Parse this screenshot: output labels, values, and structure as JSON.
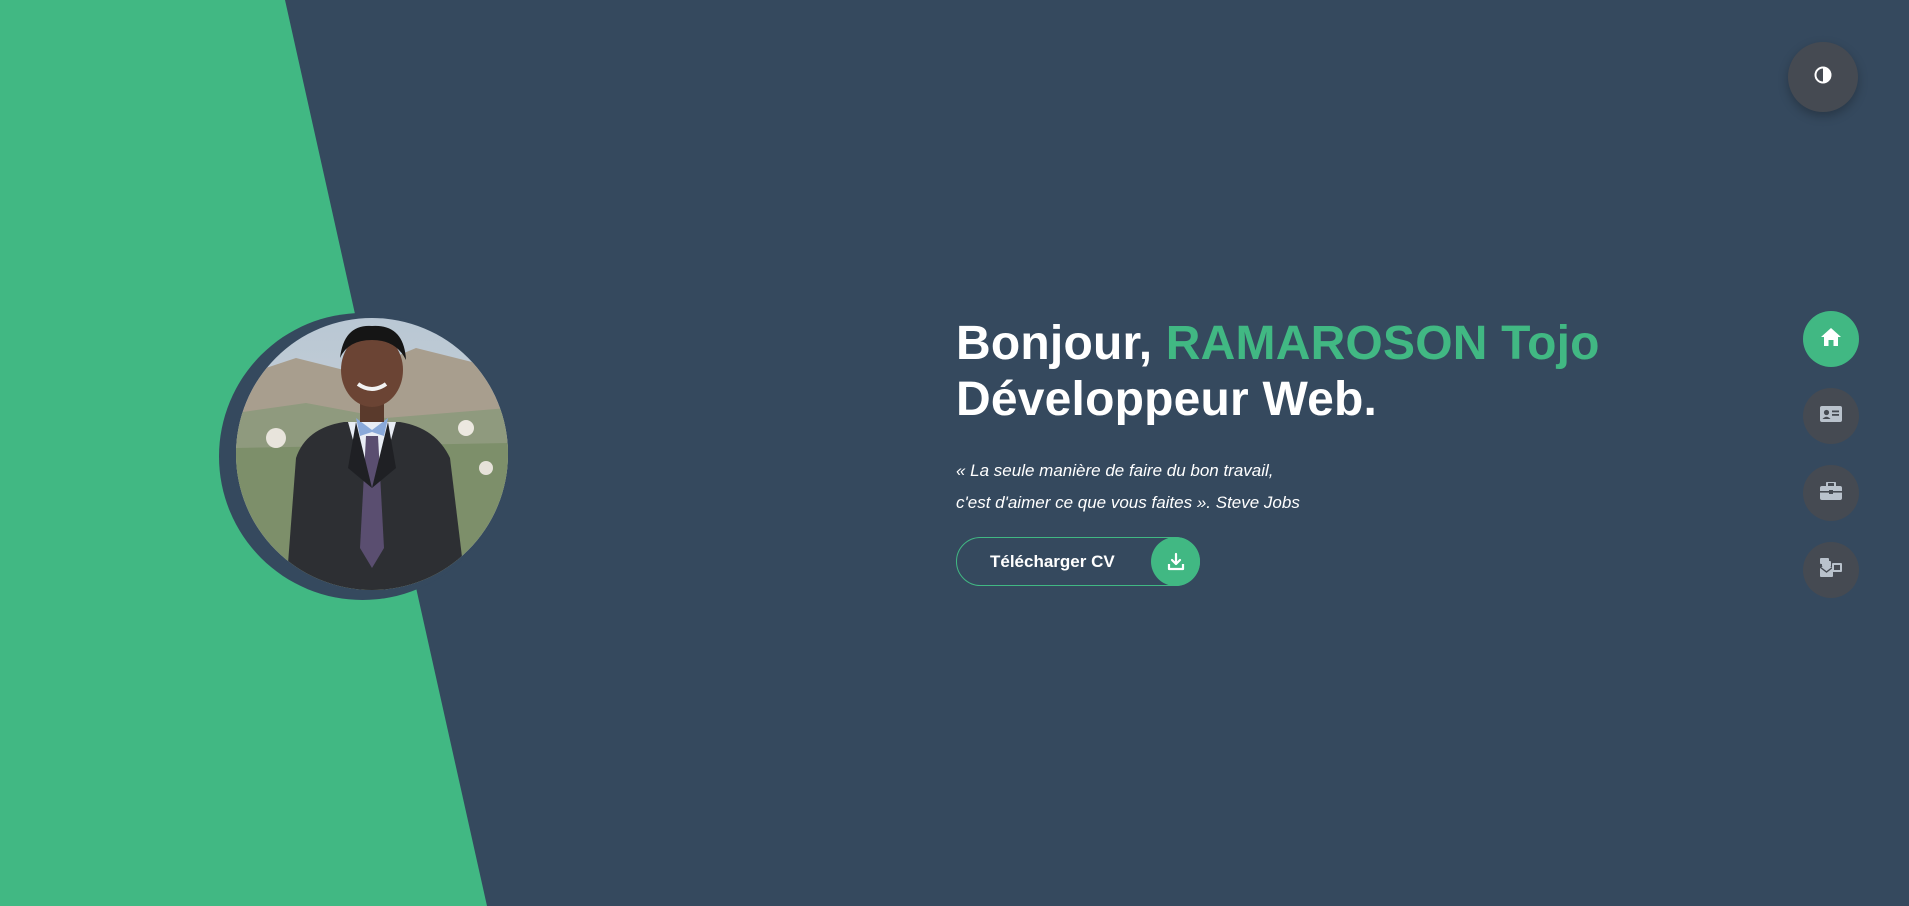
{
  "hero": {
    "greeting": "Bonjour,",
    "name": "RAMAROSON Tojo",
    "role": "Développeur Web.",
    "quote_line1": "« La seule manière de faire du bon travail,",
    "quote_line2": "c'est d'aimer ce que vous faites ». Steve Jobs"
  },
  "cv_button": {
    "label": "Télécharger CV",
    "icon": "download-icon"
  },
  "theme_toggle": {
    "icon": "contrast-icon"
  },
  "nav": {
    "items": [
      {
        "id": "home",
        "icon": "home-icon",
        "active": true
      },
      {
        "id": "about",
        "icon": "id-card-icon",
        "active": false
      },
      {
        "id": "portfolio",
        "icon": "briefcase-icon",
        "active": false
      },
      {
        "id": "contact",
        "icon": "mail-bulk-icon",
        "active": false
      }
    ]
  },
  "colors": {
    "accent": "#41b883",
    "background": "#35495e",
    "button_gray": "#454a52",
    "text": "#ffffff"
  }
}
